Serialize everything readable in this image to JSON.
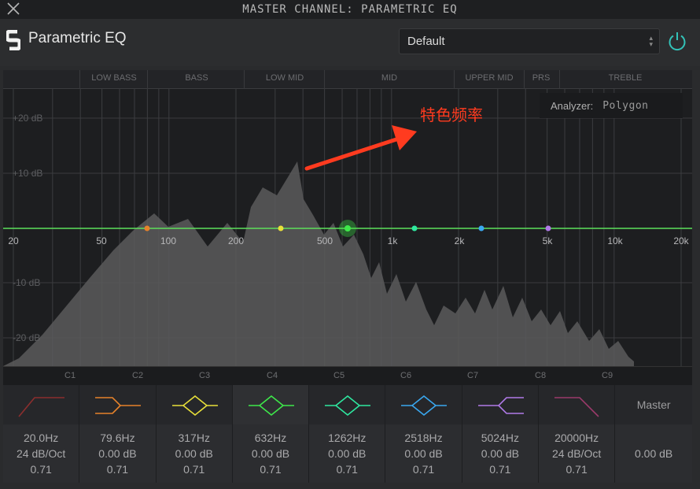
{
  "window": {
    "title": "MASTER CHANNEL: PARAMETRIC EQ"
  },
  "header": {
    "app_title": "Parametric EQ",
    "preset_value": "Default"
  },
  "band_labels": [
    "LOW BASS",
    "BASS",
    "LOW MID",
    "MID",
    "UPPER MID",
    "PRS",
    "TREBLE"
  ],
  "db_labels": [
    "+20 dB",
    "+10 dB",
    "-10 dB",
    "-20 dB"
  ],
  "freq_labels": [
    "20",
    "50",
    "100",
    "200",
    "500",
    "1k",
    "2k",
    "5k",
    "10k",
    "20k"
  ],
  "note_labels": [
    "C1",
    "C2",
    "C3",
    "C4",
    "C5",
    "C6",
    "C7",
    "C8",
    "C9"
  ],
  "analyzer": {
    "label": "Analyzer:",
    "value": "Polygon"
  },
  "annotation": {
    "text": "特色频率"
  },
  "bands": [
    {
      "freq": "20.0Hz",
      "gain": "24 dB/Oct",
      "q": "0.71",
      "color": "#8b2e2e",
      "shape": "lowcut"
    },
    {
      "freq": "79.6Hz",
      "gain": "0.00 dB",
      "q": "0.71",
      "color": "#e6822a",
      "shape": "lowshelf"
    },
    {
      "freq": "317Hz",
      "gain": "0.00 dB",
      "q": "0.71",
      "color": "#e8e03a",
      "shape": "bell"
    },
    {
      "freq": "632Hz",
      "gain": "0.00 dB",
      "q": "0.71",
      "color": "#3ee84a",
      "shape": "bell"
    },
    {
      "freq": "1262Hz",
      "gain": "0.00 dB",
      "q": "0.71",
      "color": "#2ee8a0",
      "shape": "bell"
    },
    {
      "freq": "2518Hz",
      "gain": "0.00 dB",
      "q": "0.71",
      "color": "#3aa8f0",
      "shape": "bell"
    },
    {
      "freq": "5024Hz",
      "gain": "0.00 dB",
      "q": "0.71",
      "color": "#b07ae8",
      "shape": "highshelf"
    },
    {
      "freq": "20000Hz",
      "gain": "24 dB/Oct",
      "q": "0.71",
      "color": "#9a3a6a",
      "shape": "highcut"
    }
  ],
  "master": {
    "label": "Master",
    "gain": "0.00 dB"
  },
  "colors": {
    "eq_line": "#5de05a",
    "annotation": "#ff3b1f",
    "spectrum": "#5a5a5c"
  }
}
